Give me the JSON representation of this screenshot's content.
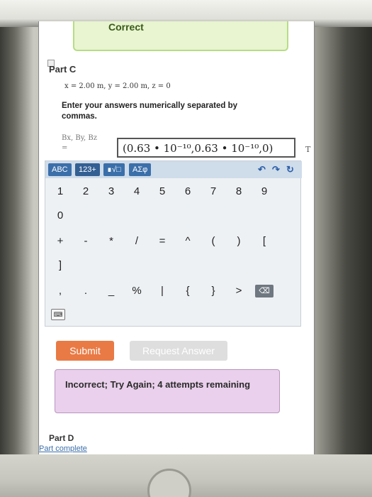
{
  "banner": {
    "label": "Correct"
  },
  "part_c": {
    "title": "Part C",
    "given": "x = 2.00 m, y = 2.00 m, z = 0",
    "instruction": "Enter your answers numerically separated by commas.",
    "answer_label": "Bx, By, Bz",
    "answer_equals": "=",
    "answer_value": "(0.63 • 10⁻¹⁰,0.63 • 10⁻¹⁰,0)",
    "unit": "T"
  },
  "keypad": {
    "tabs": [
      "ABC",
      "123+",
      "∎√□",
      "ΑΣφ"
    ],
    "row1": [
      "1",
      "2",
      "3",
      "4",
      "5",
      "6",
      "7",
      "8",
      "9"
    ],
    "row2": [
      "0"
    ],
    "row3": [
      "+",
      "-",
      "*",
      "/",
      "=",
      "^",
      "(",
      ")",
      "["
    ],
    "row4": [
      "]"
    ],
    "row5": [
      ",",
      ".",
      "_",
      "%",
      "|",
      "{",
      "}",
      ">"
    ],
    "undo": "↶",
    "redo": "↷",
    "reset": "↻",
    "backspace": "⌫",
    "keyboard_icon": "⌨"
  },
  "actions": {
    "submit": "Submit",
    "request_answer": "Request Answer"
  },
  "feedback": {
    "message": "Incorrect; Try Again; 4 attempts remaining"
  },
  "part_d": {
    "title": "Part D",
    "status": "Part complete"
  }
}
